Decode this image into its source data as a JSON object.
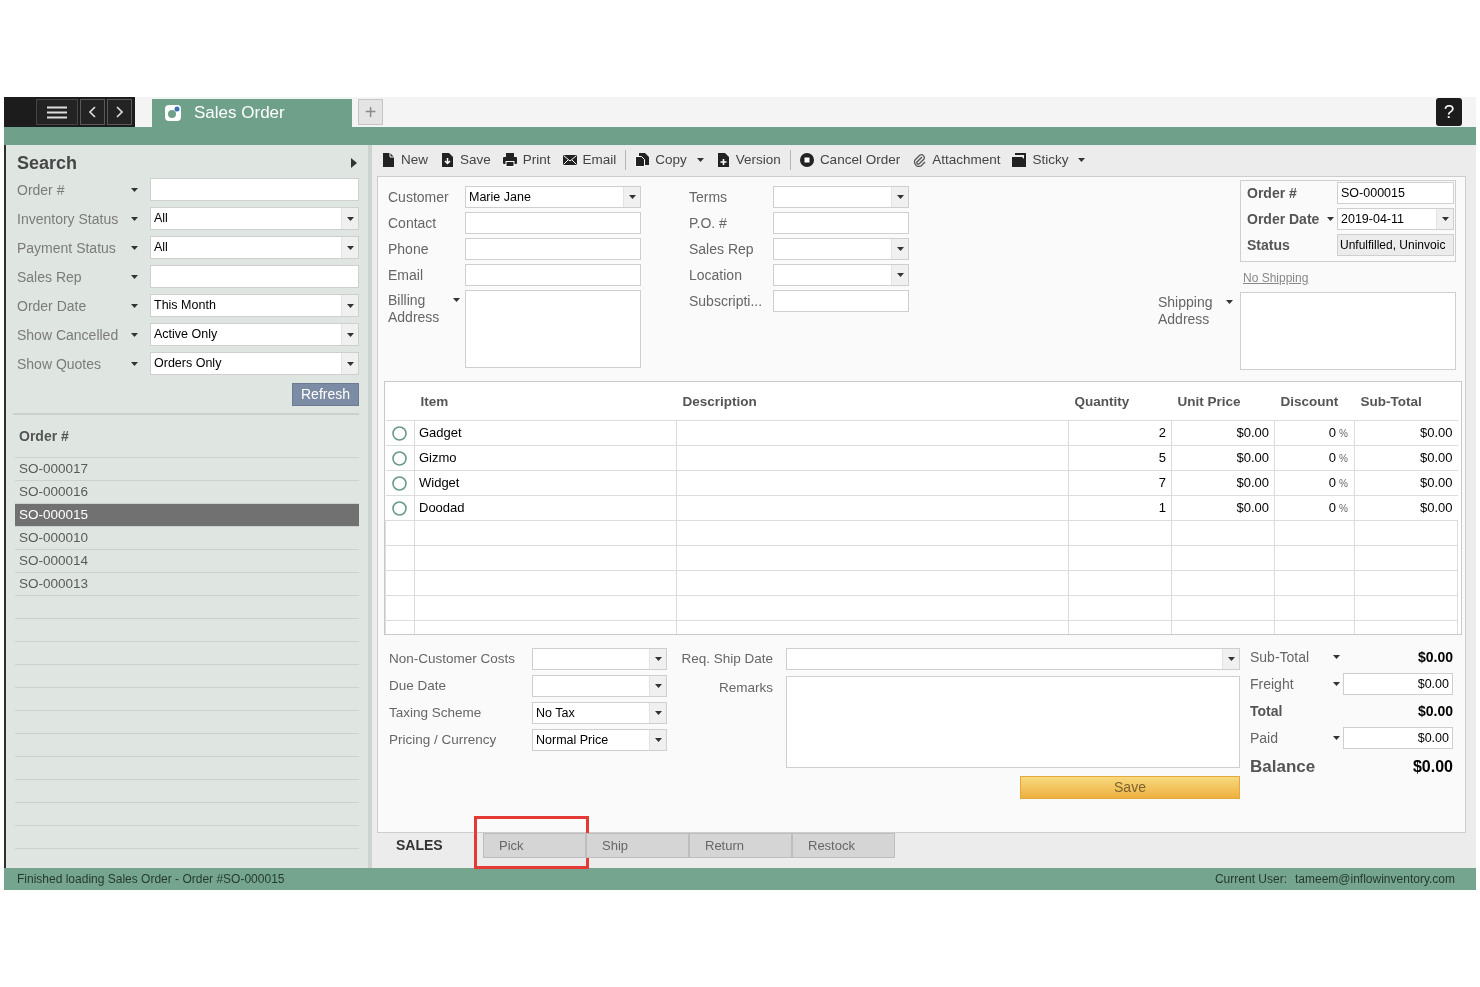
{
  "top_bar": {
    "tabs": [
      {
        "label": "Sales Order",
        "selected": true
      }
    ],
    "add_tab": "+",
    "help": "?"
  },
  "toolbar": {
    "groups": [
      [
        {
          "label": "New",
          "has_menu": false
        },
        {
          "label": "Save",
          "has_menu": false
        },
        {
          "label": "Print",
          "has_menu": false
        },
        {
          "label": "Email",
          "has_menu": false
        }
      ],
      [
        {
          "label": "Copy",
          "has_menu": true
        },
        {
          "label": "Version",
          "has_menu": false
        }
      ],
      [
        {
          "label": "Cancel Order",
          "has_menu": false
        },
        {
          "label": "Attachment",
          "has_menu": false
        },
        {
          "label": "Sticky",
          "has_menu": true
        }
      ]
    ]
  },
  "sidebar": {
    "title": "Search",
    "filters": [
      {
        "label": "Order #",
        "kind": "text",
        "has_menu": true
      },
      {
        "label": "Inventory Status",
        "kind": "dropdown",
        "value": "All",
        "has_menu": true
      },
      {
        "label": "Payment Status",
        "kind": "dropdown",
        "value": "All",
        "has_menu": true
      },
      {
        "label": "Sales Rep",
        "kind": "text",
        "has_menu": true
      },
      {
        "label": "Order Date",
        "kind": "dropdown",
        "value": "This Month",
        "has_menu": true
      },
      {
        "label": "Show Cancelled",
        "kind": "dropdown",
        "value": "Active Only",
        "has_menu": true
      },
      {
        "label": "Show Quotes",
        "kind": "dropdown",
        "value": "Orders Only",
        "has_menu": true
      }
    ],
    "refresh_button": "Refresh",
    "list": {
      "heading": "Order #",
      "rows": [
        {
          "label": "SO-000017",
          "selected": false
        },
        {
          "label": "SO-000016",
          "selected": false
        },
        {
          "label": "SO-000015",
          "selected": true
        },
        {
          "label": "SO-000010",
          "selected": false
        },
        {
          "label": "SO-000014",
          "selected": false
        },
        {
          "label": "SO-000013",
          "selected": false
        }
      ]
    }
  },
  "order_form": {
    "customer_fields": [
      {
        "label": "Customer",
        "kind": "dropdown",
        "value": "Marie Jane",
        "has_menu": false
      },
      {
        "label": "Contact",
        "kind": "text",
        "has_menu": false
      },
      {
        "label": "Phone",
        "kind": "text",
        "has_menu": false
      },
      {
        "label": "Email",
        "kind": "text",
        "has_menu": false
      },
      {
        "label": "Billing Address",
        "kind": "textarea",
        "has_menu": true
      }
    ],
    "order_fields": [
      {
        "label": "Terms",
        "kind": "dropdown"
      },
      {
        "label": "P.O. #",
        "kind": "text"
      },
      {
        "label": "Sales Rep",
        "kind": "dropdown"
      },
      {
        "label": "Location",
        "kind": "dropdown"
      },
      {
        "label": "Subscripti...",
        "kind": "text"
      }
    ],
    "order_info": [
      {
        "label": "Order #",
        "kind": "text",
        "value": "SO-000015",
        "has_menu": false
      },
      {
        "label": "Order Date",
        "kind": "dropdown",
        "value": "2019-04-11",
        "has_menu": true
      },
      {
        "label": "Status",
        "kind": "readonly",
        "value": "Unfulfilled, Uninvoic",
        "has_menu": false
      }
    ],
    "shipping_link": "No Shipping",
    "shipping_address": {
      "label": "Shipping Address",
      "kind": "textarea",
      "has_menu": true
    }
  },
  "items_table": {
    "columns": [
      "Item",
      "Description",
      "Quantity",
      "Unit Price",
      "Discount",
      "Sub-Total"
    ],
    "rows": [
      {
        "item": "Gadget",
        "quantity": "2",
        "unit_price": "$0.00",
        "discount": "0",
        "discount_unit": "%",
        "sub_total": "$0.00"
      },
      {
        "item": "Gizmo",
        "quantity": "5",
        "unit_price": "$0.00",
        "discount": "0",
        "discount_unit": "%",
        "sub_total": "$0.00"
      },
      {
        "item": "Widget",
        "quantity": "7",
        "unit_price": "$0.00",
        "discount": "0",
        "discount_unit": "%",
        "sub_total": "$0.00"
      },
      {
        "item": "Doodad",
        "quantity": "1",
        "unit_price": "$0.00",
        "discount": "0",
        "discount_unit": "%",
        "sub_total": "$0.00"
      }
    ]
  },
  "summary": {
    "cost_fields": [
      {
        "label": "Non-Customer Costs",
        "kind": "dropdown"
      },
      {
        "label": "Due Date",
        "kind": "dropdown"
      },
      {
        "label": "Taxing Scheme",
        "kind": "dropdown",
        "value": "No Tax"
      },
      {
        "label": "Pricing / Currency",
        "kind": "dropdown",
        "value": "Normal Price"
      }
    ],
    "shipping_fields": [
      {
        "label": "Req. Ship Date",
        "kind": "dropdown"
      },
      {
        "label": "Remarks",
        "kind": "textarea"
      }
    ],
    "save_button": "Save",
    "totals": [
      {
        "label": "Sub-Total",
        "kind": "value",
        "value": "$0.00",
        "has_menu": true
      },
      {
        "label": "Freight",
        "kind": "input",
        "value": "$0.00",
        "has_menu": true
      },
      {
        "label": "Total",
        "kind": "total",
        "value": "$0.00",
        "has_menu": false
      },
      {
        "label": "Paid",
        "kind": "input",
        "value": "$0.00",
        "has_menu": true
      },
      {
        "label": "Balance",
        "kind": "grand",
        "value": "$0.00",
        "has_menu": false
      }
    ]
  },
  "bottom_tabs": [
    {
      "label": "SALES",
      "selected": true,
      "highlighted": false
    },
    {
      "label": "Pick",
      "selected": false,
      "highlighted": true
    },
    {
      "label": "Ship",
      "selected": false,
      "highlighted": false
    },
    {
      "label": "Return",
      "selected": false,
      "highlighted": false
    },
    {
      "label": "Restock",
      "selected": false,
      "highlighted": false
    }
  ],
  "status_bar": {
    "message": "Finished loading Sales Order - Order #SO-000015",
    "user_label": "Current User:",
    "user": "tameem@inflowinventory.com"
  }
}
